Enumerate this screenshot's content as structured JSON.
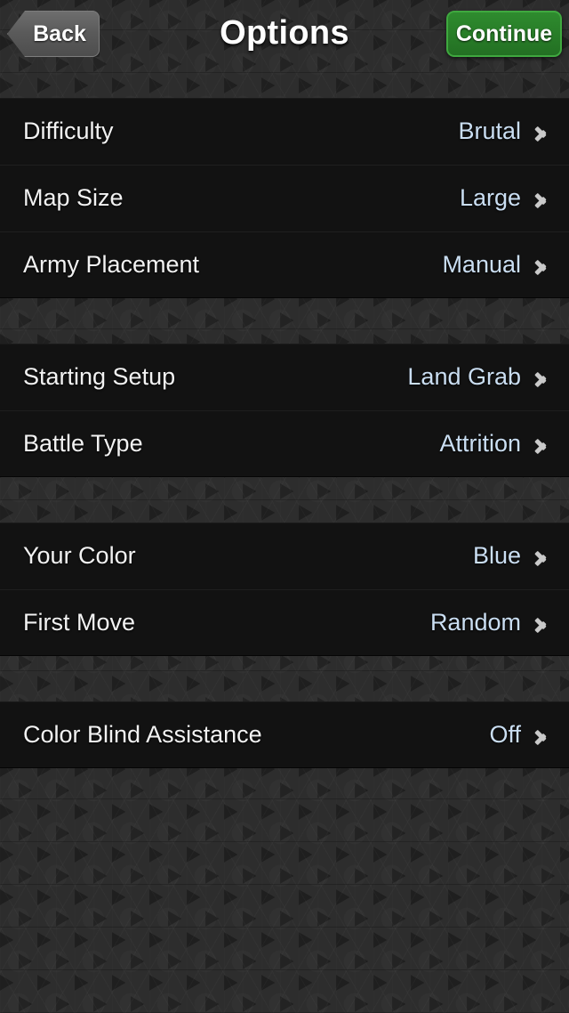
{
  "header": {
    "title": "Options",
    "back_label": "Back",
    "continue_label": "Continue"
  },
  "colors": {
    "page_background": "#2b2b2b",
    "row_background": "#121212",
    "label_text": "#f2f2f2",
    "value_text": "#cadef2",
    "continue_green": "#2e8b2e",
    "continue_border": "#3fa83f",
    "back_gray": "#5a5a5a",
    "chevron": "#c9c9c9"
  },
  "groups": [
    {
      "rows": [
        {
          "label": "Difficulty",
          "value": "Brutal",
          "icon": "chevron-right-icon"
        },
        {
          "label": "Map Size",
          "value": "Large",
          "icon": "chevron-right-icon"
        },
        {
          "label": "Army Placement",
          "value": "Manual",
          "icon": "chevron-right-icon"
        }
      ]
    },
    {
      "rows": [
        {
          "label": "Starting Setup",
          "value": "Land Grab",
          "icon": "chevron-right-icon"
        },
        {
          "label": "Battle Type",
          "value": "Attrition",
          "icon": "chevron-right-icon"
        }
      ]
    },
    {
      "rows": [
        {
          "label": "Your Color",
          "value": "Blue",
          "icon": "chevron-right-icon"
        },
        {
          "label": "First Move",
          "value": "Random",
          "icon": "chevron-right-icon"
        }
      ]
    },
    {
      "rows": [
        {
          "label": "Color Blind Assistance",
          "value": "Off",
          "icon": "chevron-right-icon"
        }
      ]
    }
  ]
}
